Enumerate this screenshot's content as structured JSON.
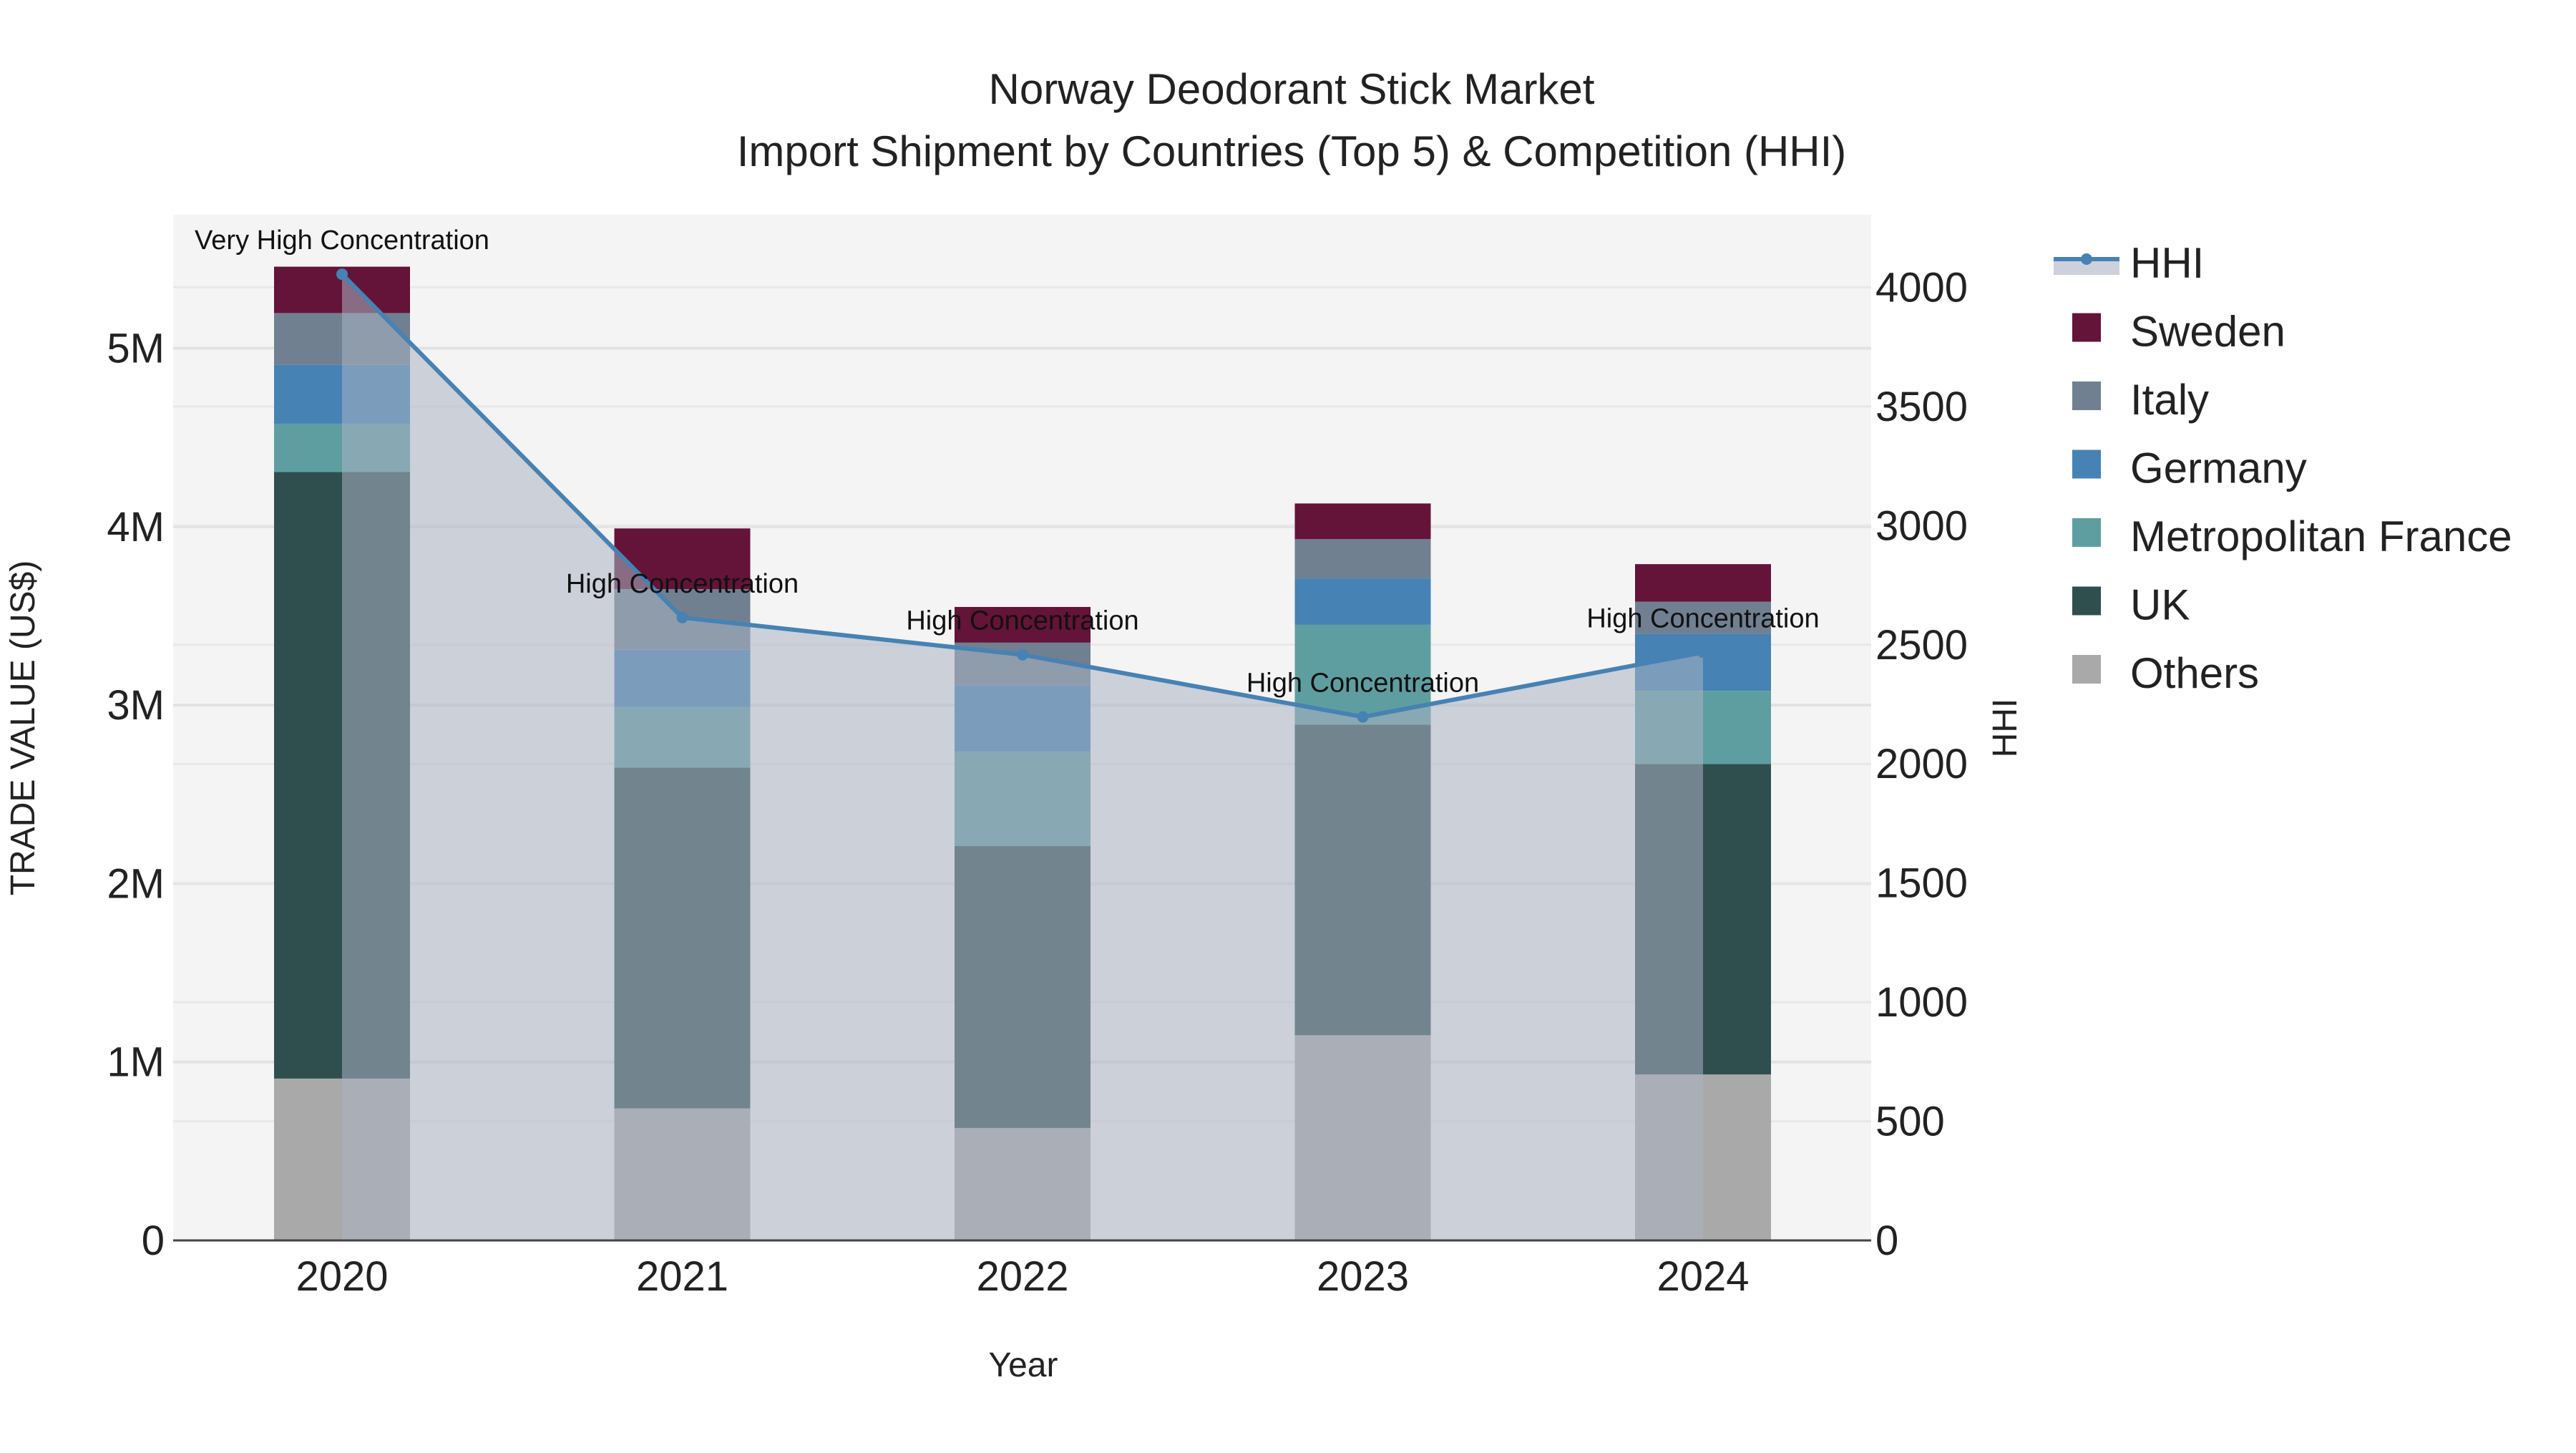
{
  "chart_data": {
    "type": "bar",
    "title_line1": "Norway Deodorant Stick Market",
    "title_line2": "Import Shipment by Countries (Top 5) & Competition (HHI)",
    "xlabel": "Year",
    "ylabel": "TRADE VALUE (US$)",
    "y2label": "HHI",
    "categories": [
      "2020",
      "2021",
      "2022",
      "2023",
      "2024"
    ],
    "ylim": [
      0,
      5500000
    ],
    "y_ticks": [
      0,
      1000000,
      2000000,
      3000000,
      4000000,
      5000000
    ],
    "y_tick_labels": [
      "0",
      "1M",
      "2M",
      "3M",
      "4M",
      "5M"
    ],
    "y2lim": [
      0,
      4300
    ],
    "y2_ticks": [
      0,
      500,
      1000,
      1500,
      2000,
      2500,
      3000,
      3500,
      4000
    ],
    "y2_tick_labels": [
      "0",
      "500",
      "1000",
      "1500",
      "2000",
      "2500",
      "3000",
      "3500",
      "4000"
    ],
    "series": [
      {
        "name": "Others",
        "color": "#a9a9a9",
        "values": [
          907000,
          740000,
          630000,
          1150000,
          930000
        ]
      },
      {
        "name": "UK",
        "color": "#2f4f4f",
        "values": [
          3400000,
          1910000,
          1580000,
          1740000,
          1740000
        ]
      },
      {
        "name": "Metropolitan France",
        "color": "#5f9ea0",
        "values": [
          270000,
          340000,
          530000,
          560000,
          410000
        ]
      },
      {
        "name": "Germany",
        "color": "#4682b4",
        "values": [
          330000,
          320000,
          370000,
          260000,
          320000
        ]
      },
      {
        "name": "Italy",
        "color": "#708090",
        "values": [
          290000,
          340000,
          240000,
          220000,
          180000
        ]
      },
      {
        "name": "Sweden",
        "color": "#641438",
        "values": [
          260000,
          340000,
          200000,
          200000,
          210000
        ]
      }
    ],
    "hhi": {
      "name": "HHI",
      "color": "#4682b4",
      "values": [
        4055,
        2614,
        2458,
        2197,
        2468
      ],
      "annotations": [
        "Very High Concentration",
        "High Concentration",
        "High Concentration",
        "High Concentration",
        "High Concentration"
      ]
    },
    "legend_order": [
      "HHI",
      "Sweden",
      "Italy",
      "Germany",
      "Metropolitan France",
      "UK",
      "Others"
    ],
    "legend_placement": "right",
    "grid": true
  }
}
